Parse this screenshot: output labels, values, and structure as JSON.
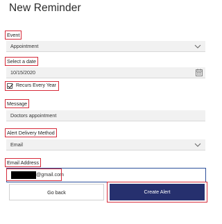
{
  "page": {
    "title": "New Reminder"
  },
  "event": {
    "label": "Event",
    "value": "Appointment"
  },
  "date": {
    "label": "Select a date",
    "value": "10/15/2020"
  },
  "recurs": {
    "label": "Recurs Every Year",
    "checked": true
  },
  "message": {
    "label": "Message",
    "value": "Doctors appointment"
  },
  "delivery": {
    "label": "Alert Delivery Method",
    "value": "Email"
  },
  "email": {
    "label": "Email Address",
    "value_suffix": "@gmail.com"
  },
  "buttons": {
    "back": "Go back",
    "create": "Create Alert"
  },
  "colors": {
    "highlight": "#d62b3a",
    "primary": "#26306e",
    "focus": "#2c4f9a"
  },
  "icons": {
    "dropdown": "chevron-down-icon",
    "calendar": "calendar-icon",
    "check": "check-icon"
  }
}
